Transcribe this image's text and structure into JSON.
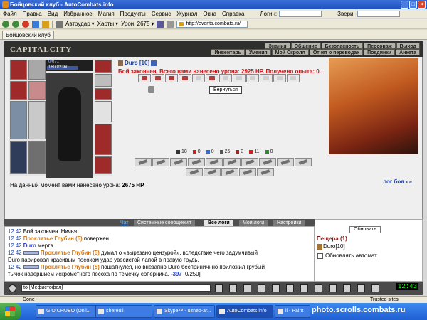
{
  "window": {
    "title": "Бойцовский клуб - AutoCombats.info"
  },
  "menubar": {
    "items": [
      "Файл",
      "Правка",
      "Вид",
      "Избранное",
      "Магия",
      "Продукты",
      "Сервис",
      "Журнал",
      "Окна",
      "Справка"
    ],
    "login_label": "Логин:",
    "fighters_label": "Звери:"
  },
  "toolbar": {
    "autoudar": "Автоудар",
    "khaoty": "Хаоты",
    "uron": "Урон: 2675",
    "url": "http://events.combats.ru/"
  },
  "tabs": [
    {
      "label": "Бойцовский клуб"
    }
  ],
  "topnav": {
    "logo": "CAPITALCITY",
    "row1": [
      "Знания",
      "Общение",
      "Безопасность",
      "Персонаж",
      "Выход"
    ],
    "row2": [
      "Инвентарь",
      "Умения",
      "Мой Скролл",
      "Отчет о переводах",
      "Поединки",
      "Анкета"
    ]
  },
  "character": {
    "hp_text": "0/671",
    "mana_text": "1600/2360",
    "hp_fraction": 0.0,
    "mana_fraction": 0.68
  },
  "opponent": {
    "name": "Duro [10]"
  },
  "fight": {
    "message": "Бой закончен. Всего вами нанесено урона: 2925 HP. Получено опыта: 0.",
    "return_label": "Вернуться"
  },
  "stats": [
    "18",
    "0",
    "0",
    "25",
    "3",
    "11",
    "0"
  ],
  "damage_now": {
    "prefix": "На данный момент вами нанесено урона:",
    "value": "2675 HP."
  },
  "fight_log_link": "лог боя »»",
  "chat_tabs": [
    "Чат",
    "Системные сообщения",
    "Все логи",
    "Мои логи",
    "Настройки"
  ],
  "chat_lines": [
    {
      "time": "12 42",
      "text": "Бой закончен. Ничья"
    },
    {
      "time": "12 42",
      "name": "Проклятье Глубин (5)",
      "text": "повержен"
    },
    {
      "time": "12 42",
      "name": "Duro",
      "text": "мертв"
    },
    {
      "time": "12 42",
      "name": "Проклятье Глубин (5)",
      "text": "думал о «вырезано цензурой», вследствие чего задумчивый"
    },
    {
      "text": "Duro парировал красивым посохом удар увесистой лапой в правую грудь."
    },
    {
      "time": "12 42",
      "name": "Проклятье Глубин (5)",
      "text": "пошатнулся, но внезапно Duro бесприничнно приложил грубый"
    },
    {
      "text": "тычок навершием искрометного посоха по темечку соперника.",
      "dmg": "-397",
      "hp": "[0/250]"
    }
  ],
  "right_panel": {
    "refresh_label": "Обновить",
    "cave_label": "Пещера (1)",
    "player": "Duro[10]",
    "auto_refresh": "Обновлять автомат."
  },
  "chat_input": {
    "value": "to [Мефистофел]"
  },
  "clock": "12:43",
  "statusbar": {
    "done": "Done",
    "zone": "Trusted sites"
  },
  "taskbar": {
    "tasks": [
      "GIO.CHUBO (Onli...",
      "shereuli",
      "Skype™ - uzneo-ar...",
      "AutoCombats.info",
      "ii - Paint"
    ],
    "watermark": "photo.scrolls.combats.ru"
  }
}
